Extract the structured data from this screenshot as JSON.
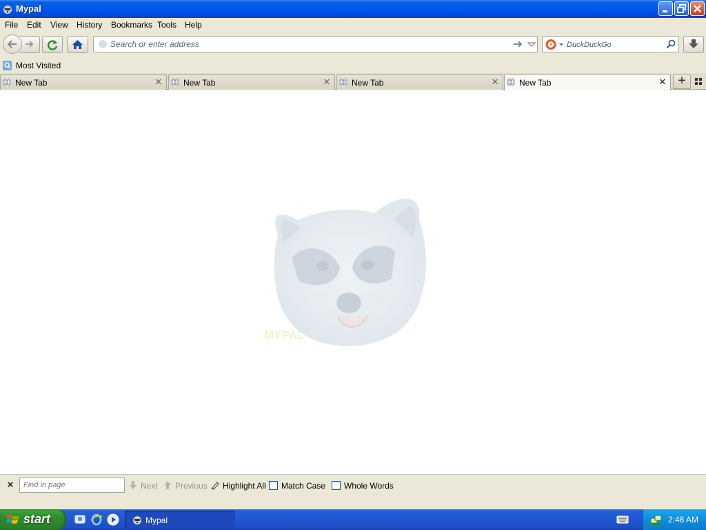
{
  "window": {
    "title": "Mypal",
    "app_icon": "raccoon-icon"
  },
  "menubar": {
    "items": [
      "File",
      "Edit",
      "View",
      "History",
      "Bookmarks",
      "Tools",
      "Help"
    ]
  },
  "navbar": {
    "url_placeholder": "Search or enter address",
    "search_engine": "DuckDuckGo",
    "search_placeholder": "DuckDuckGo"
  },
  "bookmarks": {
    "items": [
      {
        "label": "Most Visited",
        "icon": "bookmark-folder-icon"
      }
    ]
  },
  "tabs": [
    {
      "label": "New Tab",
      "selected": false
    },
    {
      "label": "New Tab",
      "selected": false
    },
    {
      "label": "New Tab",
      "selected": false
    },
    {
      "label": "New Tab",
      "selected": true
    }
  ],
  "content": {
    "logo": "MYPAL"
  },
  "findbar": {
    "placeholder": "Find in page",
    "next_label": "Next",
    "previous_label": "Previous",
    "highlight_all_label": "Highlight All",
    "match_case_label": "Match Case",
    "whole_words_label": "Whole Words",
    "match_case_checked": false,
    "whole_words_checked": false
  },
  "taskbar": {
    "start_label": "start",
    "quick_launch": [
      "show-desktop-icon",
      "internet-explorer-icon",
      "media-player-icon"
    ],
    "tasks": [
      {
        "label": "Mypal",
        "icon": "raccoon-icon"
      }
    ],
    "clock": "2:48 AM"
  },
  "colors": {
    "titlebar": "#0058ee",
    "chrome": "#ebe8d8",
    "taskbar": "#245dd7",
    "start": "#3ea93c",
    "tray": "#0f8ddc"
  }
}
